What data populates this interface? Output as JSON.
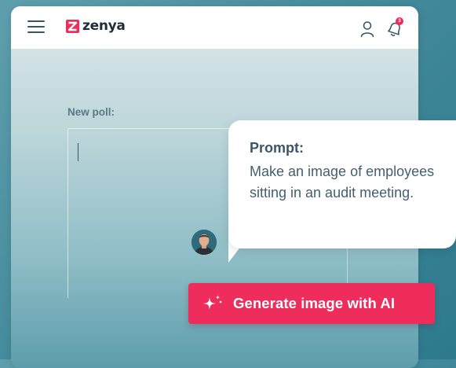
{
  "header": {
    "logo_text": "zenya",
    "notification_count": "3",
    "brand_color": "#ee2d5d",
    "icons": [
      "menu-icon",
      "zenya-logo-icon",
      "user-icon",
      "bell-icon"
    ]
  },
  "form": {
    "poll_label": "New poll:",
    "poll_value": ""
  },
  "prompt_bubble": {
    "title": "Prompt:",
    "text": "Make an image of employees sitting in an audit meeting."
  },
  "action": {
    "generate_label": "Generate image with AI",
    "icon": "sparkle-icon"
  }
}
